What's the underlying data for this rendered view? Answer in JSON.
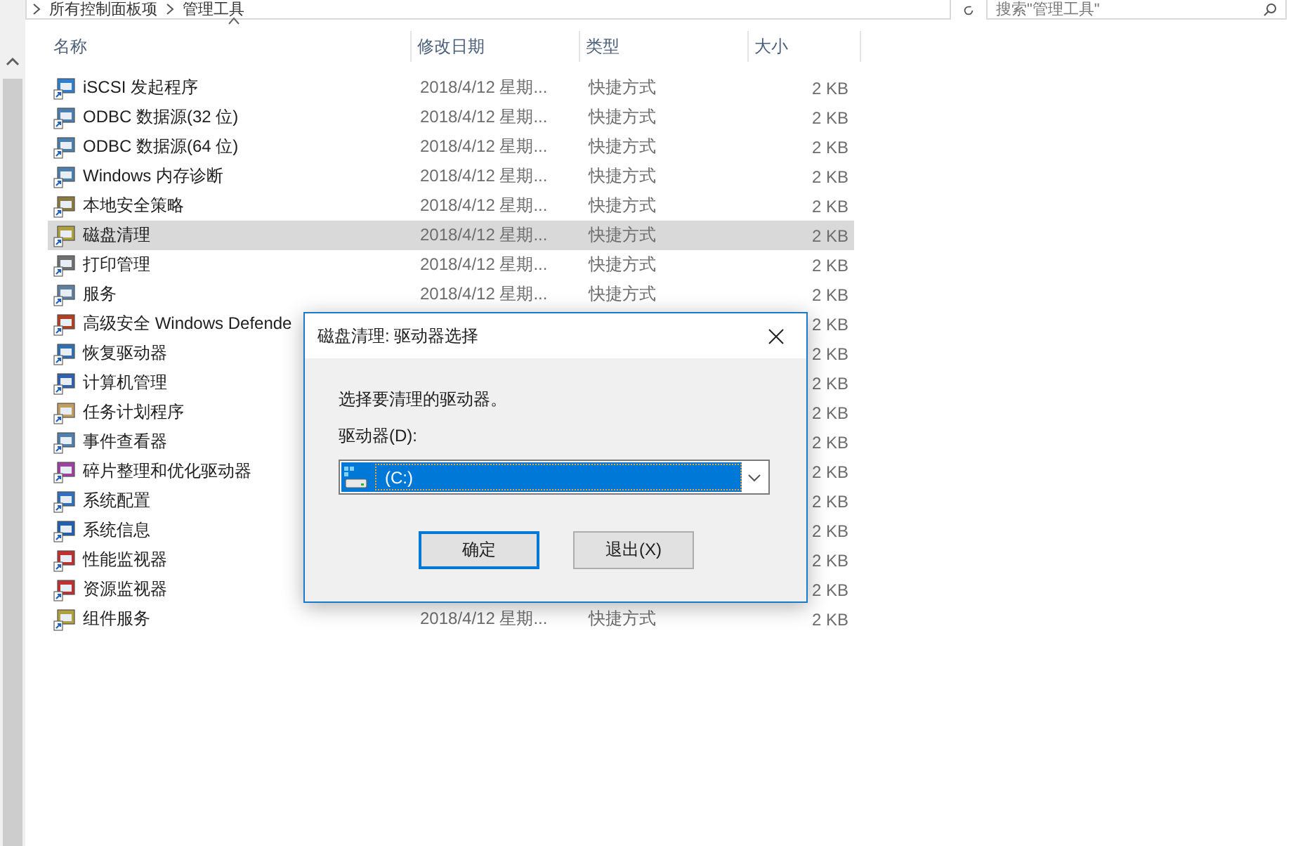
{
  "address_bar": {
    "breadcrumbs": [
      "所有控制面板项",
      "管理工具"
    ]
  },
  "search": {
    "placeholder": "搜索\"管理工具\""
  },
  "columns": [
    "名称",
    "修改日期",
    "类型",
    "大小"
  ],
  "rows": [
    {
      "name": "iSCSI 发起程序",
      "date": "2018/4/12 星期...",
      "type": "快捷方式",
      "size": "2 KB",
      "selected": false
    },
    {
      "name": "ODBC 数据源(32 位)",
      "date": "2018/4/12 星期...",
      "type": "快捷方式",
      "size": "2 KB",
      "selected": false
    },
    {
      "name": "ODBC 数据源(64 位)",
      "date": "2018/4/12 星期...",
      "type": "快捷方式",
      "size": "2 KB",
      "selected": false
    },
    {
      "name": "Windows 内存诊断",
      "date": "2018/4/12 星期...",
      "type": "快捷方式",
      "size": "2 KB",
      "selected": false
    },
    {
      "name": "本地安全策略",
      "date": "2018/4/12 星期...",
      "type": "快捷方式",
      "size": "2 KB",
      "selected": false
    },
    {
      "name": "磁盘清理",
      "date": "2018/4/12 星期...",
      "type": "快捷方式",
      "size": "2 KB",
      "selected": true
    },
    {
      "name": "打印管理",
      "date": "2018/4/12 星期...",
      "type": "快捷方式",
      "size": "2 KB",
      "selected": false
    },
    {
      "name": "服务",
      "date": "2018/4/12 星期...",
      "type": "快捷方式",
      "size": "2 KB",
      "selected": false
    },
    {
      "name": "高级安全 Windows Defende",
      "size": "2 KB",
      "selected": false
    },
    {
      "name": "恢复驱动器",
      "size": "2 KB",
      "selected": false
    },
    {
      "name": "计算机管理",
      "size": "2 KB",
      "selected": false
    },
    {
      "name": "任务计划程序",
      "size": "2 KB",
      "selected": false
    },
    {
      "name": "事件查看器",
      "size": "2 KB",
      "selected": false
    },
    {
      "name": "碎片整理和优化驱动器",
      "size": "2 KB",
      "selected": false
    },
    {
      "name": "系统配置",
      "size": "2 KB",
      "selected": false
    },
    {
      "name": "系统信息",
      "size": "2 KB",
      "selected": false
    },
    {
      "name": "性能监视器",
      "size": "2 KB",
      "selected": false
    },
    {
      "name": "资源监视器",
      "size": "2 KB",
      "selected": false
    },
    {
      "name": "组件服务",
      "date": "2018/4/12 星期...",
      "type": "快捷方式",
      "size": "2 KB",
      "selected": false
    }
  ],
  "dialog": {
    "title": "磁盘清理: 驱动器选择",
    "prompt": "选择要清理的驱动器。",
    "drive_label": "驱动器(D):",
    "drive_value": "(C:)",
    "buttons": [
      {
        "label": "确定",
        "default": true
      },
      {
        "label": "退出(X)",
        "default": false
      }
    ]
  }
}
